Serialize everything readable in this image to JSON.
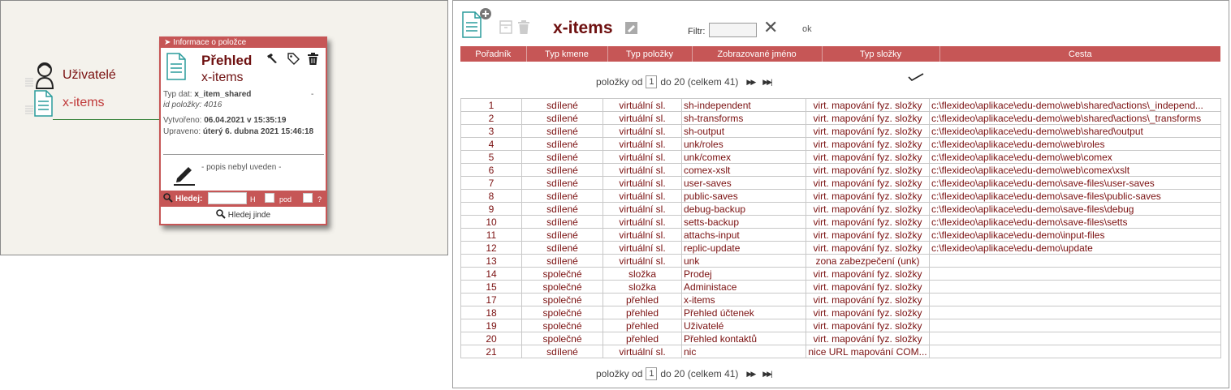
{
  "tree": {
    "users_label": "Uživatelé",
    "xitems_label": "x-items"
  },
  "popup": {
    "header": "Informace o položce",
    "title1": "Přehled",
    "title2": "x-items",
    "type_label": "Typ dat:",
    "type_value": "x_item_shared",
    "dash": "-",
    "id_label": "id položky:",
    "id_value": "4016",
    "created_label": "Vytvořeno:",
    "created_value": "06.04.2021 v 15:35:19",
    "updated_label": "Upraveno:",
    "updated_value": "úterý 6. dubna 2021 15:46:18",
    "description": "- popis nebyl uveden -",
    "search_label": "Hledej:",
    "search_h": "H",
    "search_pod": "pod",
    "search_q": "?",
    "find_elsewhere": "Hledej jinde"
  },
  "toolbar": {
    "title": "x-items",
    "filter_label": "Filtr:",
    "filter_value": "",
    "clear_glyph": "✕",
    "ok_label": "ok"
  },
  "columns": [
    "Pořadník",
    "Typ kmene",
    "Typ položky",
    "Zobrazované jméno",
    "Typ složky",
    "Cesta"
  ],
  "pager": {
    "prefix": "položky od",
    "page": "1",
    "suffix": "do 20 (celkem 41)",
    "next": "▶▶",
    "last": "▶▶|"
  },
  "rows": [
    {
      "n": "1",
      "stem": "sdílené",
      "type": "virtuální sl.",
      "name": "sh-independent",
      "folder": "virt. mapování fyz. složky",
      "path": "c:\\flexideo\\aplikace\\edu-demo\\web\\shared\\actions\\_independ..."
    },
    {
      "n": "2",
      "stem": "sdílené",
      "type": "virtuální sl.",
      "name": "sh-transforms",
      "folder": "virt. mapování fyz. složky",
      "path": "c:\\flexideo\\aplikace\\edu-demo\\web\\shared\\actions\\_transforms"
    },
    {
      "n": "3",
      "stem": "sdílené",
      "type": "virtuální sl.",
      "name": "sh-output",
      "folder": "virt. mapování fyz. složky",
      "path": "c:\\flexideo\\aplikace\\edu-demo\\web\\shared\\output"
    },
    {
      "n": "4",
      "stem": "sdílené",
      "type": "virtuální sl.",
      "name": "unk/roles",
      "folder": "virt. mapování fyz. složky",
      "path": "c:\\flexideo\\aplikace\\edu-demo\\web\\roles"
    },
    {
      "n": "5",
      "stem": "sdílené",
      "type": "virtuální sl.",
      "name": "unk/comex",
      "folder": "virt. mapování fyz. složky",
      "path": "c:\\flexideo\\aplikace\\edu-demo\\web\\comex"
    },
    {
      "n": "6",
      "stem": "sdílené",
      "type": "virtuální sl.",
      "name": "comex-xslt",
      "folder": "virt. mapování fyz. složky",
      "path": "c:\\flexideo\\aplikace\\edu-demo\\web\\comex\\xslt"
    },
    {
      "n": "7",
      "stem": "sdílené",
      "type": "virtuální sl.",
      "name": "user-saves",
      "folder": "virt. mapování fyz. složky",
      "path": "c:\\flexideo\\aplikace\\edu-demo\\save-files\\user-saves"
    },
    {
      "n": "8",
      "stem": "sdílené",
      "type": "virtuální sl.",
      "name": "public-saves",
      "folder": "virt. mapování fyz. složky",
      "path": "c:\\flexideo\\aplikace\\edu-demo\\save-files\\public-saves"
    },
    {
      "n": "9",
      "stem": "sdílené",
      "type": "virtuální sl.",
      "name": "debug-backup",
      "folder": "virt. mapování fyz. složky",
      "path": "c:\\flexideo\\aplikace\\edu-demo\\save-files\\debug"
    },
    {
      "n": "10",
      "stem": "sdílené",
      "type": "virtuální sl.",
      "name": "setts-backup",
      "folder": "virt. mapování fyz. složky",
      "path": "c:\\flexideo\\aplikace\\edu-demo\\save-files\\setts"
    },
    {
      "n": "11",
      "stem": "sdílené",
      "type": "virtuální sl.",
      "name": "attachs-input",
      "folder": "virt. mapování fyz. složky",
      "path": "c:\\flexideo\\aplikace\\edu-demo\\input-files"
    },
    {
      "n": "12",
      "stem": "sdílené",
      "type": "virtuální sl.",
      "name": "replic-update",
      "folder": "virt. mapování fyz. složky",
      "path": "c:\\flexideo\\aplikace\\edu-demo\\update"
    },
    {
      "n": "13",
      "stem": "sdílené",
      "type": "virtuální sl.",
      "name": "unk",
      "folder": "zona zabezpečení (unk)",
      "path": ""
    },
    {
      "n": "14",
      "stem": "společné",
      "type": "složka",
      "name": "Prodej",
      "folder": "virt. mapování fyz. složky",
      "path": ""
    },
    {
      "n": "15",
      "stem": "společné",
      "type": "složka",
      "name": "Administace",
      "folder": "virt. mapování fyz. složky",
      "path": ""
    },
    {
      "n": "17",
      "stem": "společné",
      "type": "přehled",
      "name": "x-items",
      "folder": "virt. mapování fyz. složky",
      "path": ""
    },
    {
      "n": "18",
      "stem": "společné",
      "type": "přehled",
      "name": "Přehled účtenek",
      "folder": "virt. mapování fyz. složky",
      "path": ""
    },
    {
      "n": "19",
      "stem": "společné",
      "type": "přehled",
      "name": "Uživatelé",
      "folder": "virt. mapování fyz. složky",
      "path": ""
    },
    {
      "n": "20",
      "stem": "společné",
      "type": "přehled",
      "name": "Přehled kontaktů",
      "folder": "virt. mapování fyz. složky",
      "path": ""
    },
    {
      "n": "21",
      "stem": "sdílené",
      "type": "virtuální sl.",
      "name": "nic",
      "folder": "nice URL mapování COM...",
      "path": ""
    }
  ]
}
